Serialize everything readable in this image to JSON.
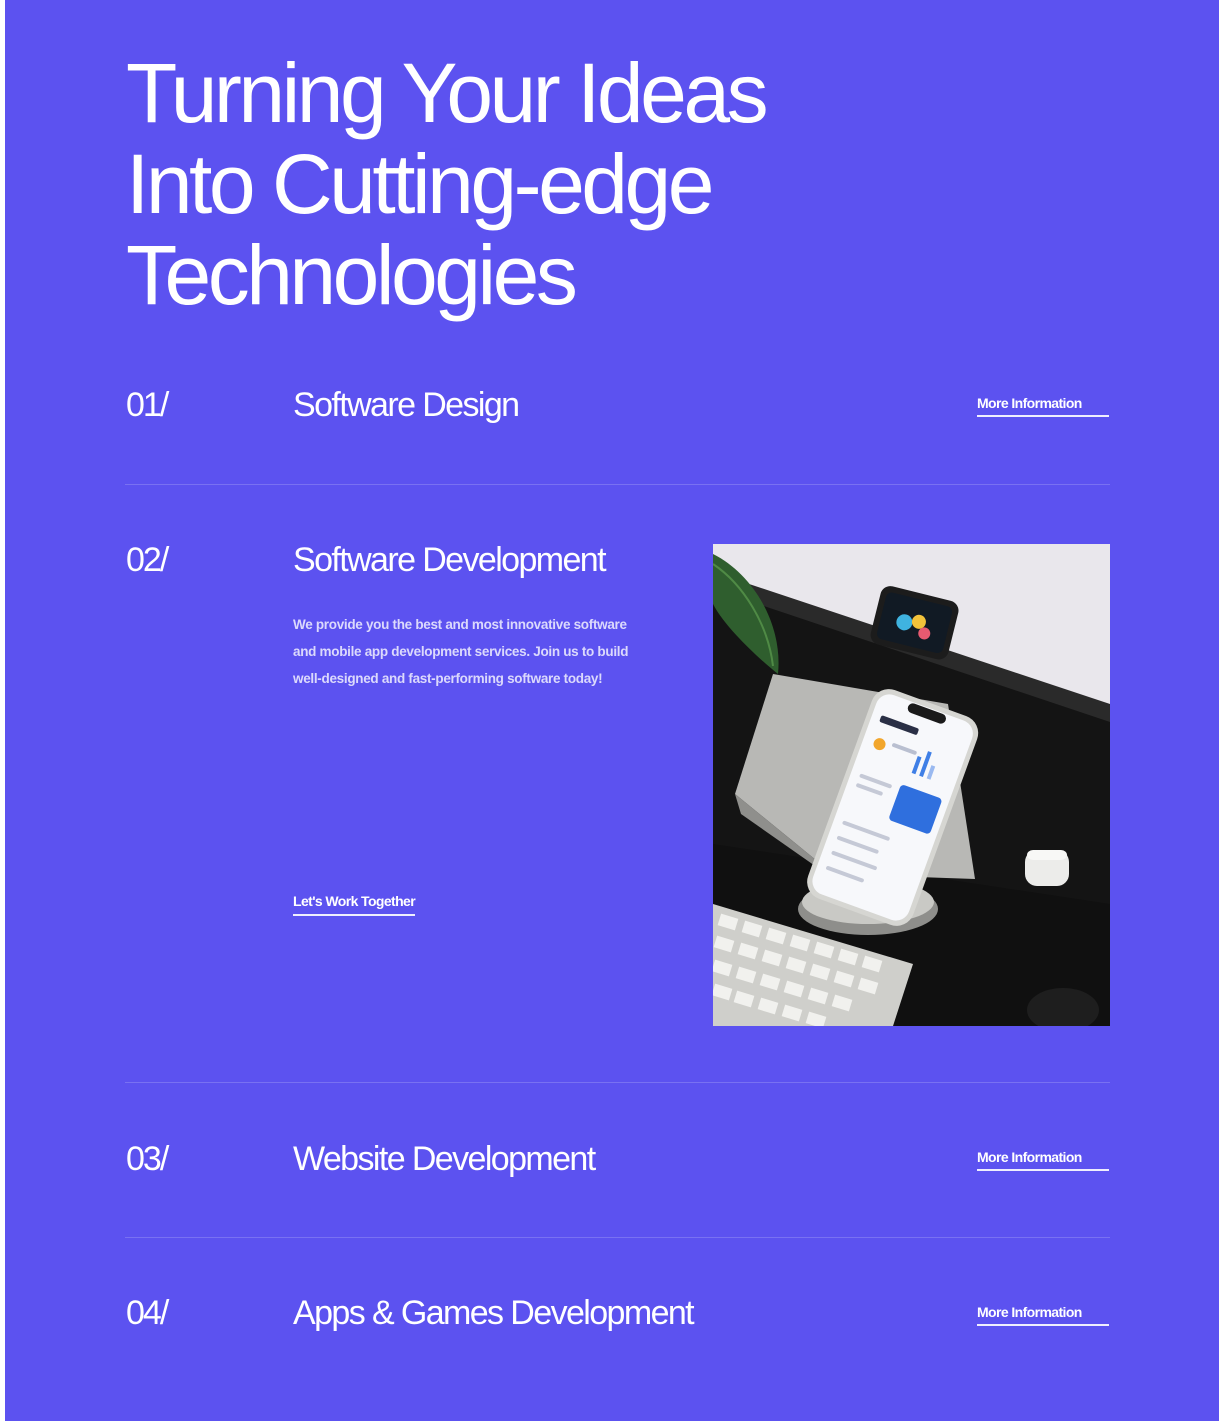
{
  "hero": {
    "title_lines": [
      "Turning Your Ideas",
      "Into Cutting-edge",
      "Technologies"
    ]
  },
  "services": [
    {
      "number": "01/",
      "title": "Software Design",
      "link": "More Information"
    },
    {
      "number": "02/",
      "title": "Software Development",
      "description": "We provide you the best and most innovative software and mobile app development services. Join us to build well-designed and fast-performing software today!",
      "cta": "Let's Work Together",
      "image_subject": "smartphone on a stand in front of a monitor and keyboard"
    },
    {
      "number": "03/",
      "title": "Website Development",
      "link": "More Information"
    },
    {
      "number": "04/",
      "title": "Apps & Games Development",
      "link": "More Information"
    }
  ],
  "colors": {
    "background": "#5c52f0",
    "text": "#ffffff",
    "divider": "rgba(255,255,255,0.18)"
  }
}
